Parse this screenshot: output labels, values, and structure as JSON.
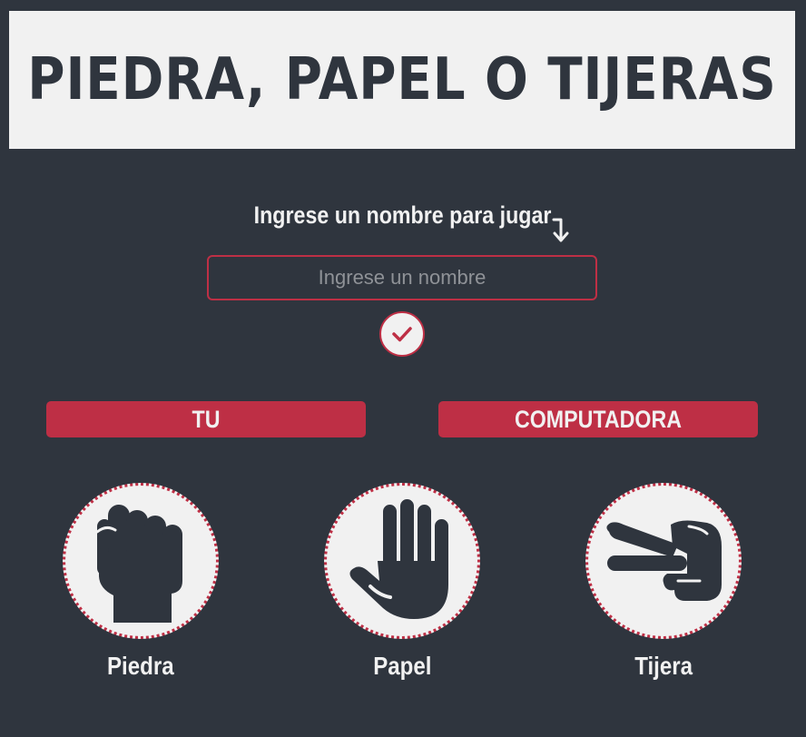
{
  "header": {
    "title": "PIEDRA, PAPEL O TIJERAS"
  },
  "name_form": {
    "prompt": "Ingrese un nombre para jugar",
    "prompt_icon": "arrow-down-turn-icon",
    "input_value": "",
    "input_placeholder": "Ingrese un nombre",
    "confirm_icon": "check-icon"
  },
  "players": {
    "you_label": "TU",
    "computer_label": "COMPUTADORA"
  },
  "choices": [
    {
      "label": "Piedra",
      "icon": "fist-icon"
    },
    {
      "label": "Papel",
      "icon": "open-hand-icon"
    },
    {
      "label": "Tijera",
      "icon": "scissors-hand-icon"
    }
  ],
  "colors": {
    "background": "#2f353e",
    "accent": "#be2f45",
    "light": "#f1f1f1"
  }
}
